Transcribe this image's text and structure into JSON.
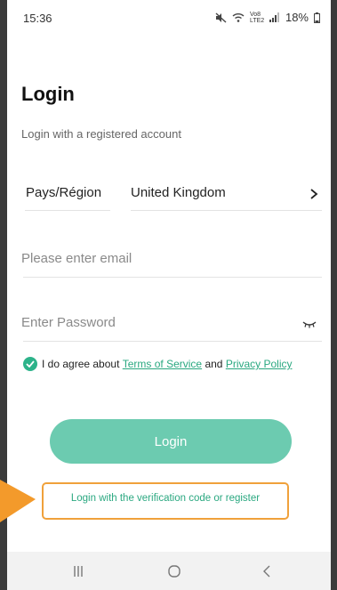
{
  "status_bar": {
    "time": "15:36",
    "network_label": "Vo8 LTE2",
    "battery": "18%"
  },
  "login": {
    "title": "Login",
    "subtitle": "Login with a registered account",
    "region_label": "Pays/Région",
    "region_value": "United Kingdom",
    "email_placeholder": "Please enter email",
    "password_placeholder": "Enter Password",
    "agree_prefix": "I do agree about ",
    "terms_link": "Terms of Service",
    "agree_and": " and ",
    "privacy_link": "Privacy Policy",
    "login_button": "Login",
    "verify_link": "Login with the verification code or register"
  },
  "icons": {
    "region_arrow": "chevron-right-icon",
    "password_toggle": "eye-closed-icon",
    "agree_check": "check-circle-icon",
    "nav": [
      "recents-icon",
      "home-icon",
      "back-icon"
    ]
  },
  "colors": {
    "accent": "#2aa880",
    "login_button": "#6ccbb0",
    "highlight_border": "#f0a13b"
  }
}
